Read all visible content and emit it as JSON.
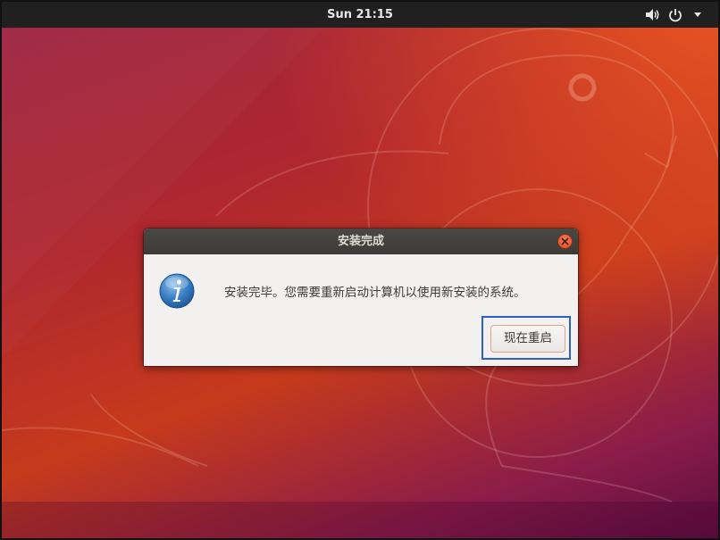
{
  "topbar": {
    "clock": "Sun 21:15",
    "tray_icons": [
      "volume-icon",
      "power-icon",
      "menu-arrow-icon"
    ]
  },
  "dialog": {
    "title": "安装完成",
    "message": "安装完毕。您需要重新启动计算机以使用新安装的系统。",
    "restart_button": "现在重启",
    "icon": "info-icon"
  },
  "colors": {
    "topbar_bg": "#202020",
    "dialog_header": "#3c3b37",
    "dialog_body": "#f2f1f0",
    "close_button": "#e95420",
    "focus_ring": "#2f5fc6"
  }
}
